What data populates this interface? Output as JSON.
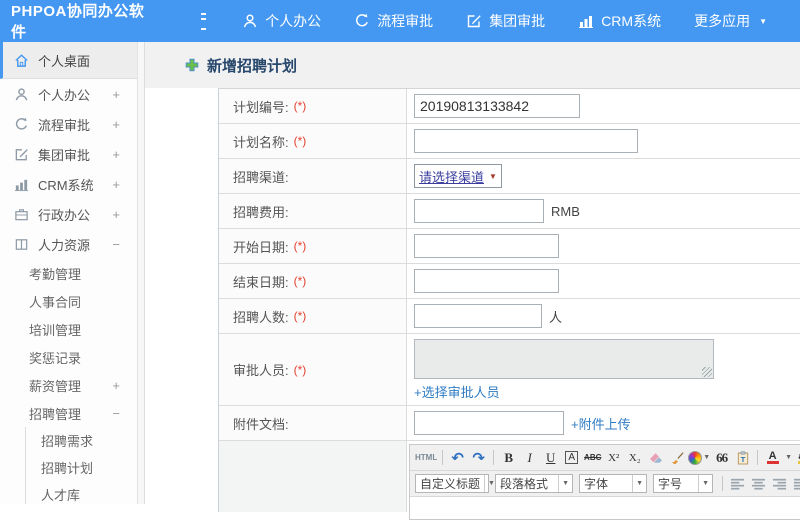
{
  "app": {
    "title": "PHPOA协同办公软件"
  },
  "icons": {
    "caret_down": "▼",
    "undo": "↶",
    "redo": "↷"
  },
  "topnav": {
    "items": [
      {
        "label": "个人办公"
      },
      {
        "label": "流程审批"
      },
      {
        "label": "集团审批"
      },
      {
        "label": "CRM系统"
      },
      {
        "label": "更多应用"
      }
    ]
  },
  "sidebar": {
    "items": [
      {
        "label": "个人桌面",
        "toggle": ""
      },
      {
        "label": "个人办公",
        "toggle": "+"
      },
      {
        "label": "流程审批",
        "toggle": "+"
      },
      {
        "label": "集团审批",
        "toggle": "+"
      },
      {
        "label": "CRM系统",
        "toggle": "+"
      },
      {
        "label": "行政办公",
        "toggle": "+"
      },
      {
        "label": "人力资源",
        "toggle": "−"
      }
    ],
    "hr_children": [
      {
        "label": "考勤管理",
        "toggle": ""
      },
      {
        "label": "人事合同",
        "toggle": ""
      },
      {
        "label": "培训管理",
        "toggle": ""
      },
      {
        "label": "奖惩记录",
        "toggle": ""
      },
      {
        "label": "薪资管理",
        "toggle": "+"
      },
      {
        "label": "招聘管理",
        "toggle": "−"
      }
    ],
    "recruit_children": [
      {
        "label": "招聘需求"
      },
      {
        "label": "招聘计划"
      },
      {
        "label": "人才库"
      }
    ]
  },
  "page": {
    "title": "新增招聘计划"
  },
  "form": {
    "required_mark": "(*)",
    "rows": [
      {
        "label": "计划编号:",
        "value": "20190813133842"
      },
      {
        "label": "计划名称:",
        "value": ""
      },
      {
        "label": "招聘渠道:",
        "select_value": "请选择渠道"
      },
      {
        "label": "招聘费用:",
        "value": "",
        "suffix": "RMB"
      },
      {
        "label": "开始日期:",
        "value": ""
      },
      {
        "label": "结束日期:",
        "value": ""
      },
      {
        "label": "招聘人数:",
        "value": "",
        "suffix": "人"
      },
      {
        "label": "审批人员:",
        "link": "+选择审批人员"
      },
      {
        "label": "附件文档:",
        "value": "",
        "link": "+附件上传"
      },
      {
        "label": ""
      }
    ]
  },
  "editor": {
    "buttons": {
      "html": "HTML",
      "bold": "B",
      "italic": "I",
      "underline": "U",
      "style_box": "A",
      "strike": "ABC",
      "sup": "X²",
      "sub": "X₂",
      "quote": "66",
      "fontcolor": "A",
      "highlight": "ab"
    },
    "dropdowns": [
      {
        "label": "自定义标题"
      },
      {
        "label": "段落格式"
      },
      {
        "label": "字体"
      },
      {
        "label": "字号"
      }
    ]
  }
}
